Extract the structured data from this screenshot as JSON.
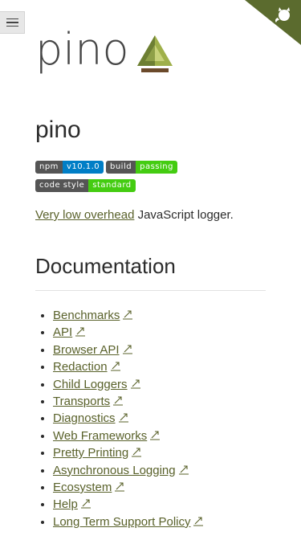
{
  "header": {
    "menu_icon": "hamburger-menu-icon",
    "corner_icon": "github-octocat-icon",
    "corner_color": "#5b6b2e"
  },
  "logo": {
    "text": "pino"
  },
  "page": {
    "title": "pino"
  },
  "badges": [
    {
      "label": "npm",
      "value": "v10.1.0",
      "color": "#007ec6"
    },
    {
      "label": "build",
      "value": "passing",
      "color": "#4c1"
    },
    {
      "label": "code style",
      "value": "standard",
      "color": "#4c1"
    }
  ],
  "intro": {
    "link_text": "Very low overhead",
    "rest_text": " JavaScript logger."
  },
  "documentation": {
    "heading": "Documentation",
    "link_icon": "external-link-icon",
    "items": [
      {
        "label": "Benchmarks"
      },
      {
        "label": "API"
      },
      {
        "label": "Browser API"
      },
      {
        "label": "Redaction"
      },
      {
        "label": "Child Loggers"
      },
      {
        "label": "Transports"
      },
      {
        "label": "Diagnostics"
      },
      {
        "label": "Web Frameworks"
      },
      {
        "label": "Pretty Printing"
      },
      {
        "label": "Asynchronous Logging"
      },
      {
        "label": "Ecosystem"
      },
      {
        "label": "Help"
      },
      {
        "label": "Long Term Support Policy"
      }
    ]
  },
  "colors": {
    "link": "#59612a",
    "text": "#2b2b2b",
    "logo_green_dark": "#5b6b2e",
    "logo_green_light": "#9fb04a",
    "logo_brown": "#6b4a2b"
  }
}
